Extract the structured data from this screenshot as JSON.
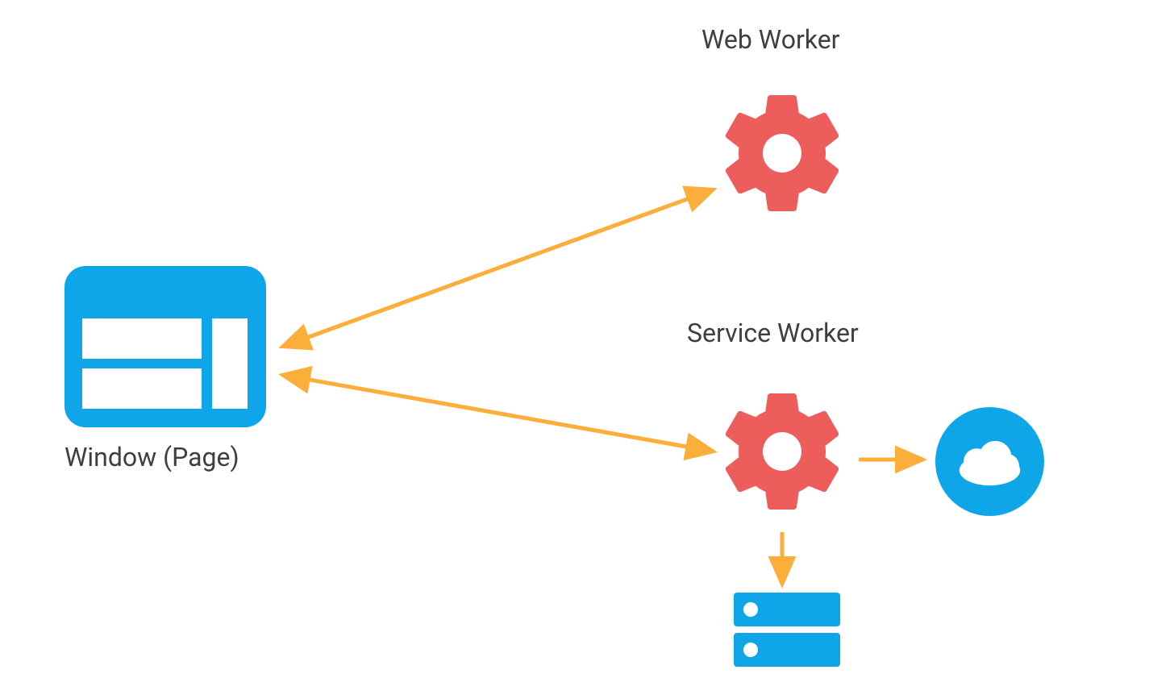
{
  "labels": {
    "window": "Window (Page)",
    "web_worker": "Web Worker",
    "service_worker": "Service Worker"
  },
  "colors": {
    "blue": "#0EA5E9",
    "red": "#ED5D5C",
    "orange": "#FBAE3A",
    "text": "#3C4043"
  },
  "nodes": [
    {
      "id": "window",
      "type": "browser-window",
      "label_key": "window"
    },
    {
      "id": "web_worker",
      "type": "gear",
      "label_key": "web_worker"
    },
    {
      "id": "service_worker",
      "type": "gear",
      "label_key": "service_worker"
    },
    {
      "id": "cloud",
      "type": "cloud"
    },
    {
      "id": "storage",
      "type": "storage"
    }
  ],
  "edges": [
    {
      "from": "window",
      "to": "web_worker",
      "bidirectional": true
    },
    {
      "from": "window",
      "to": "service_worker",
      "bidirectional": true
    },
    {
      "from": "service_worker",
      "to": "cloud",
      "bidirectional": false
    },
    {
      "from": "service_worker",
      "to": "storage",
      "bidirectional": false
    }
  ]
}
